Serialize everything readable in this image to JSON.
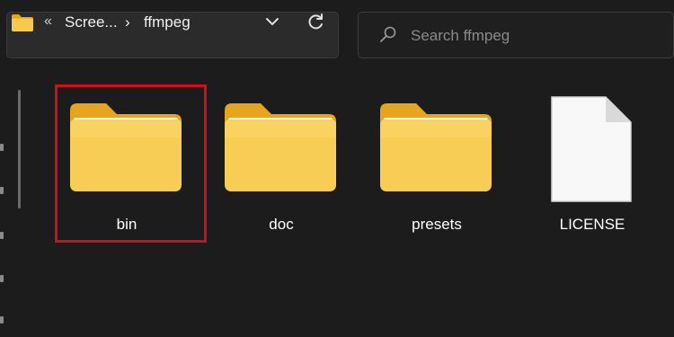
{
  "address_bar": {
    "overflow": "«",
    "breadcrumbs": [
      "Scree...",
      "ffmpeg"
    ],
    "separator": "›"
  },
  "search": {
    "placeholder": "Search ffmpeg"
  },
  "items": [
    {
      "name": "bin",
      "type": "folder",
      "selected": true
    },
    {
      "name": "doc",
      "type": "folder",
      "selected": false
    },
    {
      "name": "presets",
      "type": "folder",
      "selected": false
    },
    {
      "name": "LICENSE",
      "type": "file",
      "selected": false
    }
  ],
  "colors": {
    "background": "#1c1c1c",
    "folder": "#f7c94e",
    "highlight": "#d10f1b"
  }
}
